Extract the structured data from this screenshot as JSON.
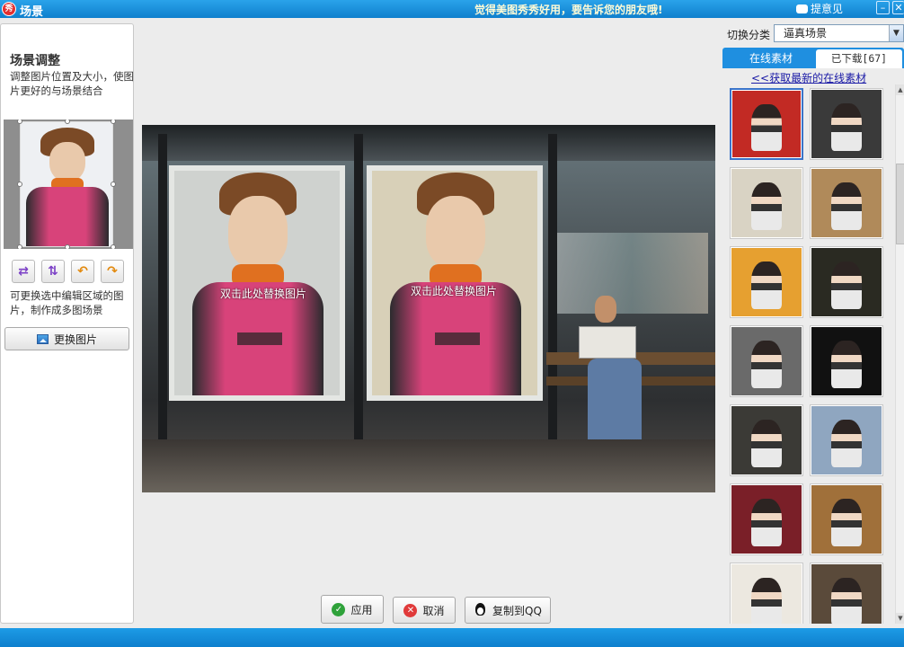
{
  "window": {
    "logo": "秀",
    "title": "场景",
    "slogan": "觉得美图秀秀好用，要告诉您的朋友哦!",
    "feedback": "提意见",
    "close": "✕"
  },
  "left_panel": {
    "title": "场景调整",
    "description": "调整图片位置及大小，使图片更好的与场景结合",
    "hint": "可更换选中编辑区域的图片，制作成多图场景",
    "replace_button": "更换图片",
    "tools": [
      {
        "name": "swap-horizontal-icon",
        "glyph": "⇄"
      },
      {
        "name": "swap-vertical-icon",
        "glyph": "⇅"
      },
      {
        "name": "rotate-left-icon",
        "glyph": "↶"
      },
      {
        "name": "rotate-right-icon",
        "glyph": "↷"
      }
    ]
  },
  "canvas": {
    "panel_label_1": "双击此处替换图片",
    "panel_label_2": "双击此处替换图片"
  },
  "actions": {
    "apply": "应用",
    "cancel": "取消",
    "copy_qq": "复制到QQ"
  },
  "right_panel": {
    "category_label": "切换分类",
    "category_value": "逼真场景",
    "tab_online": "在线素材",
    "tab_downloaded": "已下载[67]",
    "fetch_link": "<<获取最新的在线素材",
    "colors": {
      "accent": "#1f8fe0",
      "selected_border": "#3a73c9"
    },
    "scenes": [
      {
        "bg": "#c22a24",
        "selected": true
      },
      {
        "bg": "#3a3a3a",
        "selected": false
      },
      {
        "bg": "#d9d3c4",
        "selected": false
      },
      {
        "bg": "#b08a5a",
        "selected": false
      },
      {
        "bg": "#e6a030",
        "selected": false
      },
      {
        "bg": "#2a2a22",
        "selected": false
      },
      {
        "bg": "#6a6a6a",
        "selected": false
      },
      {
        "bg": "#111111",
        "selected": false
      },
      {
        "bg": "#3b3a36",
        "selected": false
      },
      {
        "bg": "#8fa6c0",
        "selected": false
      },
      {
        "bg": "#7a1f28",
        "selected": false
      },
      {
        "bg": "#a0703a",
        "selected": false
      },
      {
        "bg": "#ece8e0",
        "selected": false
      },
      {
        "bg": "#5a4a3a",
        "selected": false
      }
    ]
  }
}
